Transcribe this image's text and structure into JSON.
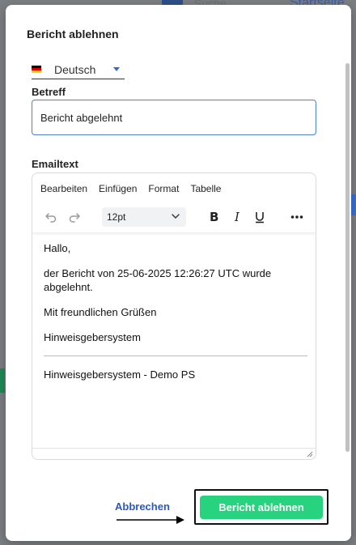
{
  "background": {
    "search_label": "Suche",
    "start_label": "Startseite"
  },
  "modal": {
    "title": "Bericht ablehnen",
    "language": {
      "selected": "Deutsch",
      "flag_icon": "germany-flag-icon"
    },
    "subject": {
      "label": "Betreff",
      "value": "Bericht abgelehnt"
    },
    "email": {
      "label": "Emailtext",
      "menu": [
        "Bearbeiten",
        "Einfügen",
        "Format",
        "Tabelle"
      ],
      "font_size": "12pt",
      "body": {
        "greeting": "Hallo,",
        "message": "der Bericht von 25-06-2025 12:26:27 UTC wurde abgelehnt.",
        "closing": "Mit freundlichen Grüßen",
        "signature": "Hinweisgebersystem",
        "footer": "Hinweisgebersystem - Demo PS"
      }
    },
    "actions": {
      "cancel_label": "Abbrechen",
      "reject_label": "Bericht ablehnen"
    }
  },
  "colors": {
    "accent_blue": "#2b58c4",
    "reject_green": "#27d37f",
    "input_border": "#4d82c8"
  }
}
